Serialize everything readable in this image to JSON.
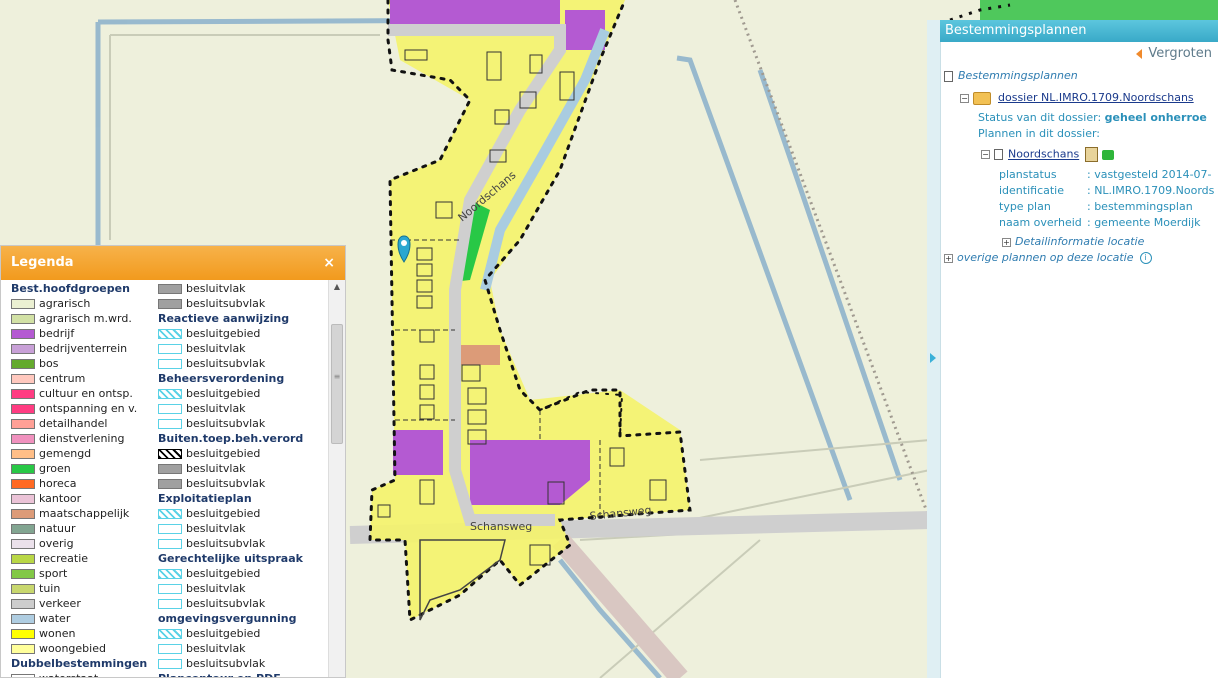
{
  "map": {
    "streets": [
      "Noordschans",
      "Schansweg",
      "Schansweg"
    ]
  },
  "legend": {
    "title": "Legenda",
    "close_label": "×",
    "col1": [
      {
        "type": "head",
        "label": "Best.hoofdgroepen"
      },
      {
        "type": "item",
        "label": "agrarisch",
        "color": "#ebf0d2"
      },
      {
        "type": "item",
        "label": "agrarisch m.wrd.",
        "color": "#d2e1a5"
      },
      {
        "type": "item",
        "label": "bedrijf",
        "color": "#b45ad2"
      },
      {
        "type": "item",
        "label": "bedrijventerrein",
        "color": "#c8a0d7"
      },
      {
        "type": "item",
        "label": "bos",
        "color": "#64aa2d"
      },
      {
        "type": "item",
        "label": "centrum",
        "color": "#ffc8be"
      },
      {
        "type": "item",
        "label": "cultuur en ontsp.",
        "color": "#ff3c82"
      },
      {
        "type": "item",
        "label": "ontspanning en v.",
        "color": "#ff3c82"
      },
      {
        "type": "item",
        "label": "detailhandel",
        "color": "#ffa096"
      },
      {
        "type": "item",
        "label": "dienstverlening",
        "color": "#f091be"
      },
      {
        "type": "item",
        "label": "gemengd",
        "color": "#ffbe87"
      },
      {
        "type": "item",
        "label": "groen",
        "color": "#28c846"
      },
      {
        "type": "item",
        "label": "horeca",
        "color": "#ff6923"
      },
      {
        "type": "item",
        "label": "kantoor",
        "color": "#ebc3d7"
      },
      {
        "type": "item",
        "label": "maatschappelijk",
        "color": "#dc9b78"
      },
      {
        "type": "item",
        "label": "natuur",
        "color": "#82a591"
      },
      {
        "type": "item",
        "label": "overig",
        "color": "#ebe1eb"
      },
      {
        "type": "item",
        "label": "recreatie",
        "color": "#b9d746"
      },
      {
        "type": "item",
        "label": "sport",
        "color": "#82c846"
      },
      {
        "type": "item",
        "label": "tuin",
        "color": "#c8d76e"
      },
      {
        "type": "item",
        "label": "verkeer",
        "color": "#cdcdcd"
      },
      {
        "type": "item",
        "label": "water",
        "color": "#afcde1"
      },
      {
        "type": "item",
        "label": "wonen",
        "color": "#ffff00"
      },
      {
        "type": "item",
        "label": "woongebied",
        "color": "#ffff9b"
      },
      {
        "type": "head",
        "label": "Dubbelbestemmingen"
      },
      {
        "type": "item",
        "label": "waterstaat",
        "color": "#ffffff"
      }
    ],
    "col2": [
      {
        "type": "item",
        "label": "besluitvlak",
        "color": "#a0a0a0"
      },
      {
        "type": "item",
        "label": "besluitsubvlak",
        "color": "#a0a0a0"
      },
      {
        "type": "head",
        "label": "Reactieve aanwijzing"
      },
      {
        "type": "hatch",
        "label": "besluitgebied",
        "color": "#5ad2e6"
      },
      {
        "type": "outline",
        "label": "besluitvlak",
        "color": "#5ad2e6"
      },
      {
        "type": "outline",
        "label": "besluitsubvlak",
        "color": "#5ad2e6"
      },
      {
        "type": "head",
        "label": "Beheersverordening"
      },
      {
        "type": "hatch",
        "label": "besluitgebied",
        "color": "#5ad2e6"
      },
      {
        "type": "outline",
        "label": "besluitvlak",
        "color": "#5ad2e6"
      },
      {
        "type": "outline",
        "label": "besluitsubvlak",
        "color": "#5ad2e6"
      },
      {
        "type": "head",
        "label": "Buiten.toep.beh.verord"
      },
      {
        "type": "hatch",
        "label": "besluitgebied",
        "color": "#000000"
      },
      {
        "type": "item",
        "label": "besluitvlak",
        "color": "#a0a0a0"
      },
      {
        "type": "item",
        "label": "besluitsubvlak",
        "color": "#a0a0a0"
      },
      {
        "type": "head",
        "label": "Exploitatieplan"
      },
      {
        "type": "hatch",
        "label": "besluitgebied",
        "color": "#5ad2e6"
      },
      {
        "type": "outline",
        "label": "besluitvlak",
        "color": "#5ad2e6"
      },
      {
        "type": "outline",
        "label": "besluitsubvlak",
        "color": "#5ad2e6"
      },
      {
        "type": "head",
        "label": "Gerechtelijke uitspraak"
      },
      {
        "type": "hatch",
        "label": "besluitgebied",
        "color": "#5ad2e6"
      },
      {
        "type": "outline",
        "label": "besluitvlak",
        "color": "#5ad2e6"
      },
      {
        "type": "outline",
        "label": "besluitsubvlak",
        "color": "#5ad2e6"
      },
      {
        "type": "head",
        "label": "omgevingsvergunning"
      },
      {
        "type": "hatch",
        "label": "besluitgebied",
        "color": "#5ad2e6"
      },
      {
        "type": "outline",
        "label": "besluitvlak",
        "color": "#5ad2e6"
      },
      {
        "type": "outline",
        "label": "besluitsubvlak",
        "color": "#5ad2e6"
      },
      {
        "type": "head",
        "label": "Plancontour en PDF"
      }
    ]
  },
  "panel": {
    "title": "Bestemmingsplannen",
    "enlarge_label": "Vergroten",
    "root_label": "Bestemmingsplannen",
    "dossier_label": "dossier NL.IMRO.1709.Noordschans",
    "status_label": "Status van dit dossier:",
    "status_value": "geheel onherroe",
    "plans_label": "Plannen in dit dossier:",
    "plan_name": "Noordschans",
    "props": [
      {
        "key": "planstatus",
        "value": ": vastgesteld 2014-07-"
      },
      {
        "key": "identificatie",
        "value": ": NL.IMRO.1709.Noords"
      },
      {
        "key": "type plan",
        "value": ": bestemmingsplan"
      },
      {
        "key": "naam overheid",
        "value": ": gemeente Moerdijk"
      }
    ],
    "detail_label": "Detailinformatie locatie",
    "other_label": "overige plannen op deze locatie"
  },
  "colors": {
    "accent_orange": "#f29a1d",
    "accent_blue": "#39a9c8",
    "wonen": "#ffff00",
    "bedrijf": "#b45ad2",
    "groen": "#28c846"
  }
}
